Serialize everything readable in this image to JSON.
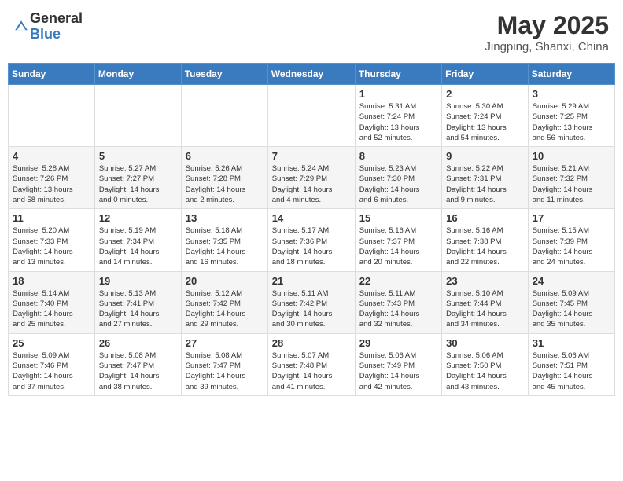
{
  "header": {
    "logo_general": "General",
    "logo_blue": "Blue",
    "month_title": "May 2025",
    "location": "Jingping, Shanxi, China"
  },
  "days_of_week": [
    "Sunday",
    "Monday",
    "Tuesday",
    "Wednesday",
    "Thursday",
    "Friday",
    "Saturday"
  ],
  "weeks": [
    [
      {
        "day": "",
        "info": ""
      },
      {
        "day": "",
        "info": ""
      },
      {
        "day": "",
        "info": ""
      },
      {
        "day": "",
        "info": ""
      },
      {
        "day": "1",
        "info": "Sunrise: 5:31 AM\nSunset: 7:24 PM\nDaylight: 13 hours\nand 52 minutes."
      },
      {
        "day": "2",
        "info": "Sunrise: 5:30 AM\nSunset: 7:24 PM\nDaylight: 13 hours\nand 54 minutes."
      },
      {
        "day": "3",
        "info": "Sunrise: 5:29 AM\nSunset: 7:25 PM\nDaylight: 13 hours\nand 56 minutes."
      }
    ],
    [
      {
        "day": "4",
        "info": "Sunrise: 5:28 AM\nSunset: 7:26 PM\nDaylight: 13 hours\nand 58 minutes."
      },
      {
        "day": "5",
        "info": "Sunrise: 5:27 AM\nSunset: 7:27 PM\nDaylight: 14 hours\nand 0 minutes."
      },
      {
        "day": "6",
        "info": "Sunrise: 5:26 AM\nSunset: 7:28 PM\nDaylight: 14 hours\nand 2 minutes."
      },
      {
        "day": "7",
        "info": "Sunrise: 5:24 AM\nSunset: 7:29 PM\nDaylight: 14 hours\nand 4 minutes."
      },
      {
        "day": "8",
        "info": "Sunrise: 5:23 AM\nSunset: 7:30 PM\nDaylight: 14 hours\nand 6 minutes."
      },
      {
        "day": "9",
        "info": "Sunrise: 5:22 AM\nSunset: 7:31 PM\nDaylight: 14 hours\nand 9 minutes."
      },
      {
        "day": "10",
        "info": "Sunrise: 5:21 AM\nSunset: 7:32 PM\nDaylight: 14 hours\nand 11 minutes."
      }
    ],
    [
      {
        "day": "11",
        "info": "Sunrise: 5:20 AM\nSunset: 7:33 PM\nDaylight: 14 hours\nand 13 minutes."
      },
      {
        "day": "12",
        "info": "Sunrise: 5:19 AM\nSunset: 7:34 PM\nDaylight: 14 hours\nand 14 minutes."
      },
      {
        "day": "13",
        "info": "Sunrise: 5:18 AM\nSunset: 7:35 PM\nDaylight: 14 hours\nand 16 minutes."
      },
      {
        "day": "14",
        "info": "Sunrise: 5:17 AM\nSunset: 7:36 PM\nDaylight: 14 hours\nand 18 minutes."
      },
      {
        "day": "15",
        "info": "Sunrise: 5:16 AM\nSunset: 7:37 PM\nDaylight: 14 hours\nand 20 minutes."
      },
      {
        "day": "16",
        "info": "Sunrise: 5:16 AM\nSunset: 7:38 PM\nDaylight: 14 hours\nand 22 minutes."
      },
      {
        "day": "17",
        "info": "Sunrise: 5:15 AM\nSunset: 7:39 PM\nDaylight: 14 hours\nand 24 minutes."
      }
    ],
    [
      {
        "day": "18",
        "info": "Sunrise: 5:14 AM\nSunset: 7:40 PM\nDaylight: 14 hours\nand 25 minutes."
      },
      {
        "day": "19",
        "info": "Sunrise: 5:13 AM\nSunset: 7:41 PM\nDaylight: 14 hours\nand 27 minutes."
      },
      {
        "day": "20",
        "info": "Sunrise: 5:12 AM\nSunset: 7:42 PM\nDaylight: 14 hours\nand 29 minutes."
      },
      {
        "day": "21",
        "info": "Sunrise: 5:11 AM\nSunset: 7:42 PM\nDaylight: 14 hours\nand 30 minutes."
      },
      {
        "day": "22",
        "info": "Sunrise: 5:11 AM\nSunset: 7:43 PM\nDaylight: 14 hours\nand 32 minutes."
      },
      {
        "day": "23",
        "info": "Sunrise: 5:10 AM\nSunset: 7:44 PM\nDaylight: 14 hours\nand 34 minutes."
      },
      {
        "day": "24",
        "info": "Sunrise: 5:09 AM\nSunset: 7:45 PM\nDaylight: 14 hours\nand 35 minutes."
      }
    ],
    [
      {
        "day": "25",
        "info": "Sunrise: 5:09 AM\nSunset: 7:46 PM\nDaylight: 14 hours\nand 37 minutes."
      },
      {
        "day": "26",
        "info": "Sunrise: 5:08 AM\nSunset: 7:47 PM\nDaylight: 14 hours\nand 38 minutes."
      },
      {
        "day": "27",
        "info": "Sunrise: 5:08 AM\nSunset: 7:47 PM\nDaylight: 14 hours\nand 39 minutes."
      },
      {
        "day": "28",
        "info": "Sunrise: 5:07 AM\nSunset: 7:48 PM\nDaylight: 14 hours\nand 41 minutes."
      },
      {
        "day": "29",
        "info": "Sunrise: 5:06 AM\nSunset: 7:49 PM\nDaylight: 14 hours\nand 42 minutes."
      },
      {
        "day": "30",
        "info": "Sunrise: 5:06 AM\nSunset: 7:50 PM\nDaylight: 14 hours\nand 43 minutes."
      },
      {
        "day": "31",
        "info": "Sunrise: 5:06 AM\nSunset: 7:51 PM\nDaylight: 14 hours\nand 45 minutes."
      }
    ]
  ]
}
